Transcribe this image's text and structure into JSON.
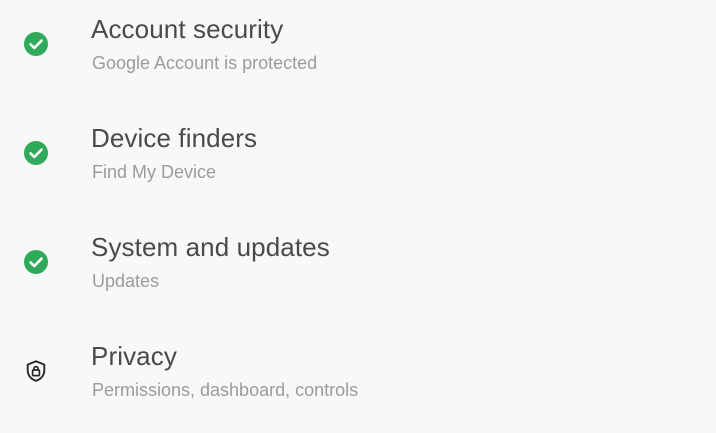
{
  "colors": {
    "background": "#f8f8f8",
    "check_green": "#2faa5a",
    "title": "#4a4a4a",
    "subtitle": "#9b9b9b",
    "privacy_icon": "#2a2a2a"
  },
  "items": [
    {
      "title": "Account security",
      "subtitle": "Google Account is protected",
      "icon": "check-circle-icon",
      "status": "ok"
    },
    {
      "title": "Device finders",
      "subtitle": "Find My Device",
      "icon": "check-circle-icon",
      "status": "ok"
    },
    {
      "title": "System and updates",
      "subtitle": "Updates",
      "icon": "check-circle-icon",
      "status": "ok"
    },
    {
      "title": "Privacy",
      "subtitle": "Permissions, dashboard, controls",
      "icon": "shield-lock-icon",
      "status": "none"
    }
  ]
}
